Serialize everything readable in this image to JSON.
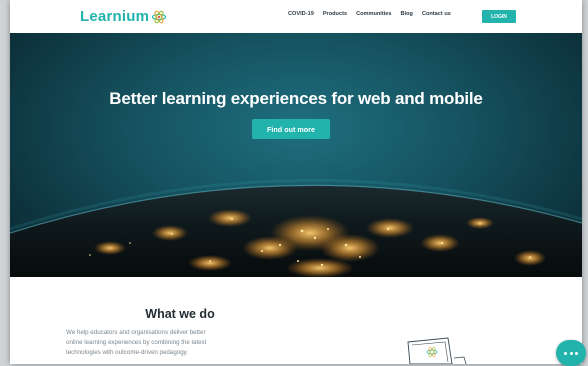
{
  "brand": {
    "name": "Learnium",
    "icon": "atom-logo-icon",
    "accent": "#23b3ad"
  },
  "nav": {
    "links": [
      "COVID-19",
      "Products",
      "Communities",
      "Blog",
      "Contact us"
    ],
    "login_label": "LOGIN"
  },
  "hero": {
    "title": "Better learning experiences for web and mobile",
    "cta_label": "Find out more"
  },
  "section": {
    "title": "What we do",
    "lines": [
      "We help educators and organisations deliver better",
      "online learning experiences by combining the latest",
      "technologies with outcome-driven pedagogy."
    ]
  },
  "chat": {
    "icon": "chat-dots-icon"
  }
}
